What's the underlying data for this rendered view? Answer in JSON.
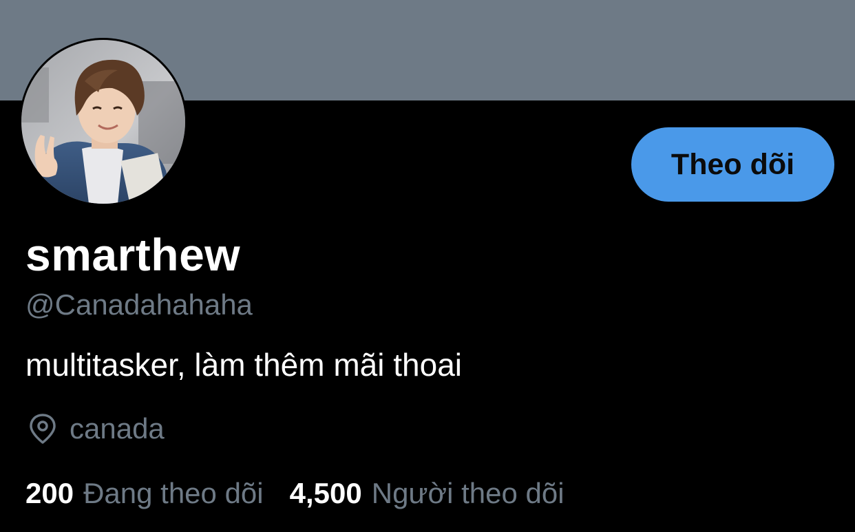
{
  "colors": {
    "banner": "#6e7a86",
    "background": "#000000",
    "accent": "#4a99e9",
    "muted_text": "#6e7a86",
    "primary_text": "#ffffff"
  },
  "profile": {
    "display_name": "smarthew",
    "handle": "@Canadahahaha",
    "bio": "multitasker, làm thêm mãi thoai",
    "location": "canada",
    "location_icon": "location-pin-icon"
  },
  "actions": {
    "follow_label": "Theo dõi"
  },
  "stats": {
    "following": {
      "count": "200",
      "label": "Đang theo dõi"
    },
    "followers": {
      "count": "4,500",
      "label": "Người theo dõi"
    }
  }
}
